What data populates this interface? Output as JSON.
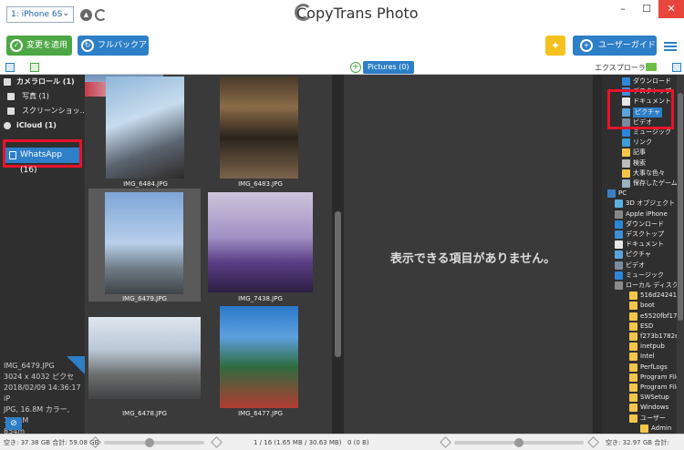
{
  "titlebar": {
    "device": "1: iPhone 6S",
    "app_title": "CopyTrans Photo",
    "min": "–",
    "max": "☐",
    "close": "✕"
  },
  "toolbar": {
    "apply": "変更を適用",
    "backup": "フルバックアップ",
    "guide": "ユーザーガイド"
  },
  "subhead": {
    "pictures_tab": "Pictures (0)",
    "explorer": "エクスプローラー"
  },
  "sidebar": {
    "items": [
      {
        "label": "カメラロール (1)",
        "bold": true
      },
      {
        "label": "写真 (1)"
      },
      {
        "label": "スクリーンショッ..."
      },
      {
        "label": "iCloud (1)",
        "bold": true
      }
    ],
    "whatsapp": "WhatsApp (16)",
    "info": [
      "IMG_6479.JPG",
      "3024 x 4032 ピクセ",
      "2018/02/09 14:36:17 iP",
      "JPG, 16.8M カラー, 1.65 M",
      "854m"
    ]
  },
  "thumbnails": [
    {
      "name": "IMG_6484.JPG",
      "selected": false
    },
    {
      "name": "IMG_6483.JPG",
      "selected": false
    },
    {
      "name": "IMG_6479.JPG",
      "selected": true
    },
    {
      "name": "IMG_7438.JPG",
      "selected": false
    },
    {
      "name": "IMG_6478.JPG",
      "selected": false
    },
    {
      "name": "IMG_6477.JPG",
      "selected": false
    }
  ],
  "center": {
    "empty_message": "表示できる項目がありません。"
  },
  "tree": [
    {
      "label": "ダウンロード",
      "icon": "ic-dl"
    },
    {
      "label": "デスクトップ",
      "icon": "ic-desk"
    },
    {
      "label": "ドキュメント",
      "icon": "ic-doc"
    },
    {
      "label": "ピクチャ",
      "icon": "ic-pic",
      "hl": true
    },
    {
      "label": "ビデオ",
      "icon": "ic-vid"
    },
    {
      "label": "ミュージック",
      "icon": "ic-music"
    },
    {
      "label": "リンク",
      "icon": "ic-link"
    },
    {
      "label": "記事",
      "icon": "ic-folder"
    },
    {
      "label": "検索",
      "icon": "ic-search"
    },
    {
      "label": "大事な色々",
      "icon": "ic-folder"
    },
    {
      "label": "保存したゲーム",
      "icon": "ic-game"
    },
    {
      "label": "PC",
      "icon": "ic-pc"
    },
    {
      "label": "3D オブジェクト",
      "icon": "ic-3d"
    },
    {
      "label": "Apple iPhone",
      "icon": "ic-phone"
    },
    {
      "label": "ダウンロード",
      "icon": "ic-dl"
    },
    {
      "label": "デスクトップ",
      "icon": "ic-desk"
    },
    {
      "label": "ドキュメント",
      "icon": "ic-doc"
    },
    {
      "label": "ピクチャ",
      "icon": "ic-pic"
    },
    {
      "label": "ビデオ",
      "icon": "ic-vid"
    },
    {
      "label": "ミュージック",
      "icon": "ic-music"
    },
    {
      "label": "ローカル ディスク",
      "icon": "ic-drive"
    },
    {
      "label": "516d24241e",
      "icon": "ic-folder"
    },
    {
      "label": "boot",
      "icon": "ic-folder"
    },
    {
      "label": "e5520fbf17",
      "icon": "ic-folder"
    },
    {
      "label": "ESD",
      "icon": "ic-folder"
    },
    {
      "label": "f273b1782e",
      "icon": "ic-folder"
    },
    {
      "label": "inetpub",
      "icon": "ic-folder"
    },
    {
      "label": "Intel",
      "icon": "ic-folder"
    },
    {
      "label": "PerfLogs",
      "icon": "ic-folder"
    },
    {
      "label": "Program Files",
      "icon": "ic-folder"
    },
    {
      "label": "Program Files",
      "icon": "ic-folder"
    },
    {
      "label": "SWSetup",
      "icon": "ic-folder"
    },
    {
      "label": "Windows",
      "icon": "ic-folder"
    },
    {
      "label": "ユーザー",
      "icon": "ic-folder"
    },
    {
      "label": "Admin",
      "icon": "ic-folder"
    }
  ],
  "bottombar": {
    "left_storage": "空き: 37.38 GB 合計: 59.08 GB",
    "grid_status": "1 / 16 (1.65 MB / 30.63 MB)",
    "center_status": "0 (0 B)",
    "right_storage": "空き: 32.97 GB 合計: 232.80 GB"
  }
}
